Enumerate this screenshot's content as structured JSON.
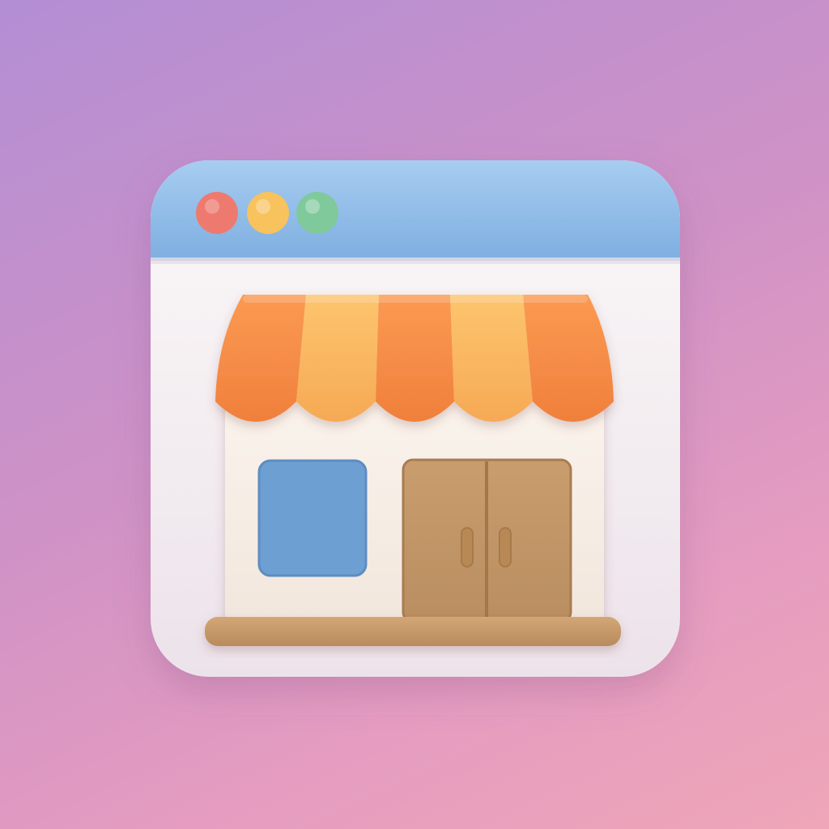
{
  "icon": {
    "name": "online-store-icon",
    "colors": {
      "background_top": "#b38ed4",
      "background_bottom": "#eea6b8",
      "window_body": "#f4eef0",
      "titlebar": "#8ab6e3",
      "dot_red": "#ee7a6f",
      "dot_yellow": "#f8c25d",
      "dot_green": "#7fc99b",
      "awning_orange": "#f68d45",
      "awning_yellow": "#f9b45e",
      "storefront": "#f7efe6",
      "shop_window": "#6d9fd3",
      "door": "#c19466",
      "door_handle": "#b88955",
      "base_ledge": "#c79a6a"
    },
    "window_controls": [
      "close-dot",
      "minimize-dot",
      "maximize-dot"
    ]
  }
}
